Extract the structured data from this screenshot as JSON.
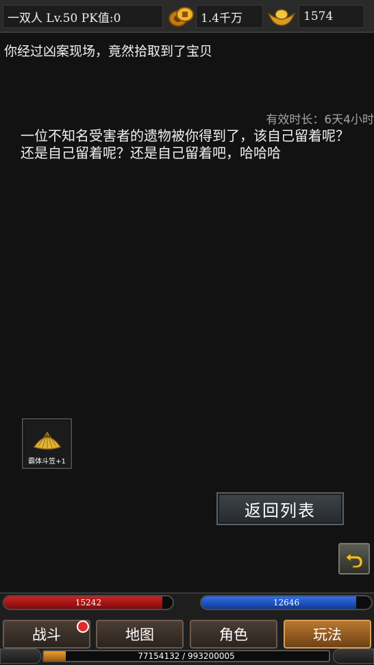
{
  "topbar": {
    "player": "一双人  Lv.50 PK值:0",
    "gold_icon": "gold-coins-icon",
    "gold": "1.4千万",
    "ingot_icon": "gold-ingot-icon",
    "ingot": "1574"
  },
  "mail": {
    "headline": "你经过凶案现场，竟然拾取到了宝贝",
    "duration": "有效时长：6天4小时",
    "message": "一位不知名受害者的遗物被你得到了，该自己留着呢？还是自己留着呢？还是自己留着吧，哈哈哈",
    "item": {
      "icon": "bamboo-hat-icon",
      "name": "霸体斗笠+1"
    },
    "return_button": "返回列表"
  },
  "back_button": {
    "icon": "return-arrow-icon"
  },
  "hud": {
    "hp": "15242",
    "hp_fill": 0.94,
    "mp": "12646",
    "mp_fill": 0.91,
    "tabs": [
      {
        "label": "战斗"
      },
      {
        "label": "地图"
      },
      {
        "label": "角色"
      },
      {
        "label": "玩法"
      }
    ],
    "active_tab": "玩法",
    "exp": "77154132 / 993200005",
    "exp_fill": 0.078
  },
  "colors": {
    "background": "#121212",
    "hp": "#d12020",
    "mp": "#2f6ff0",
    "active_tab": "#b9772f",
    "notification": "#e22a2a"
  }
}
